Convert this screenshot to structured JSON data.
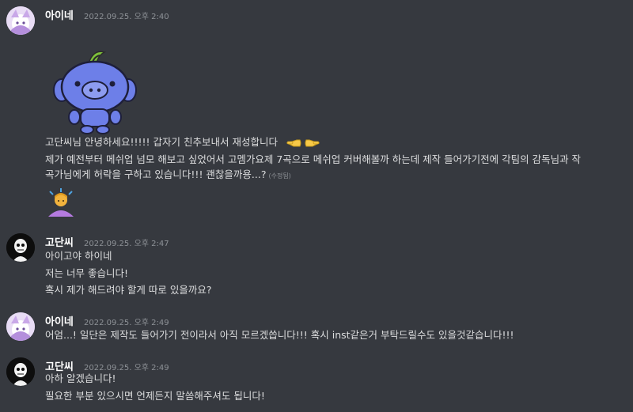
{
  "messages": [
    {
      "username": "아이네",
      "timestamp": "2022.09.25. 오후 2:40",
      "lines": [
        "고단씨님 안녕하세요!!!!! 갑자기 친추보내서 재성합니다",
        "제가 예전부터 메쉬업 넘모 해보고 싶었어서 고멤가요제 7곡으로 메쉬업 커버해볼까 하는데 제작 들어가기전에 각팀의 감독님과 작",
        "곡가님에게 허락을 구하고 있습니다!!! 괜찮을까용...?"
      ],
      "edited_label": "(수정됨)"
    },
    {
      "username": "고단씨",
      "timestamp": "2022.09.25. 오후 2:47",
      "lines": [
        "아이고야 하이네",
        "저는 너무 좋습니다!",
        "혹시 제가 해드려야 할게 따로 있을까요?"
      ]
    },
    {
      "username": "아이네",
      "timestamp": "2022.09.25. 오후 2:49",
      "lines": [
        "어엄...! 일단은 제작도 들어가기 전이라서 아직 모르겠씁니다!!! 혹시 inst같은거 부탁드릴수도 있을것같습니다!!!"
      ]
    },
    {
      "username": "고단씨",
      "timestamp": "2022.09.25. 오후 2:49",
      "lines": [
        "아하 알겠습니다!",
        "필요한 부분 있으시면 언제든지 말씀해주셔도 됩니다!"
      ]
    }
  ],
  "icons": {
    "sticker": "wumpus-sticker-icon",
    "inline_emoji": "pointing-fingers-emoji-icon",
    "big_emoji": "person-bowing-emoji-icon"
  },
  "colors": {
    "background": "#36393f",
    "username": "#ffffff",
    "text": "#dcddde",
    "timestamp": "#8e9297"
  }
}
